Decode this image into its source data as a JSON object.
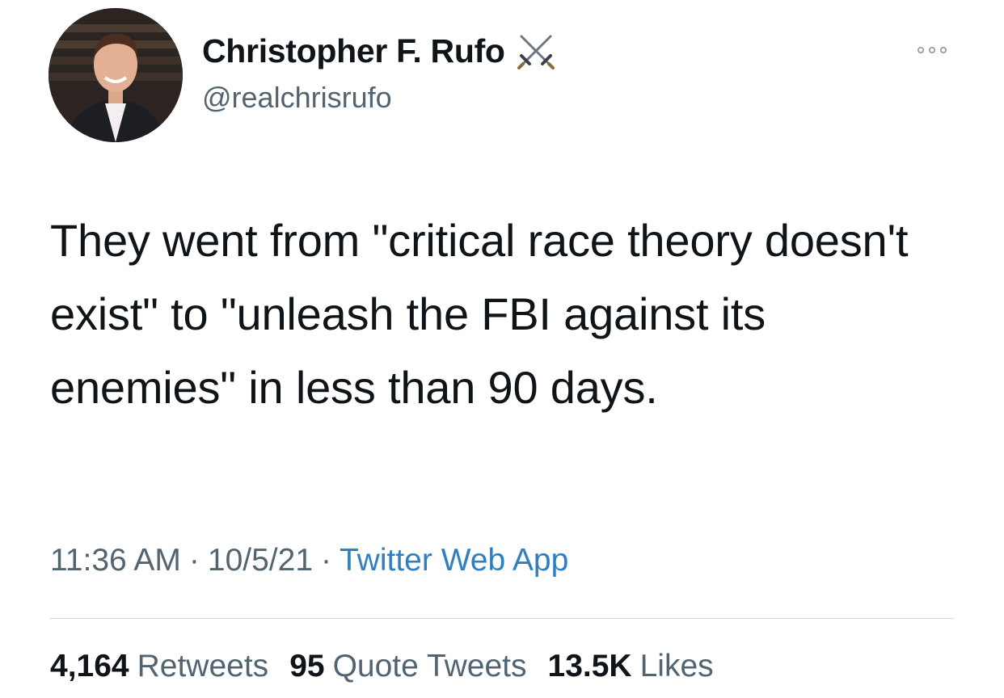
{
  "author": {
    "display_name": "Christopher F. Rufo",
    "handle": "@realchrisrufo",
    "name_icon": "crossed-swords-icon"
  },
  "tweet": {
    "text": "They went from \"critical race theory doesn't exist\" to \"unleash the FBI against its enemies\" in less than 90 days."
  },
  "meta": {
    "time": "11:36 AM",
    "date": "10/5/21",
    "separator": "·",
    "source": "Twitter Web App"
  },
  "stats": {
    "retweets_count": "4,164",
    "retweets_label": "Retweets",
    "quotes_count": "95",
    "quotes_label": "Quote Tweets",
    "likes_count": "13.5K",
    "likes_label": "Likes"
  },
  "colors": {
    "text_primary": "#0f1419",
    "text_secondary": "#536471",
    "link": "#2f7fc1",
    "divider": "#cfd9de"
  }
}
